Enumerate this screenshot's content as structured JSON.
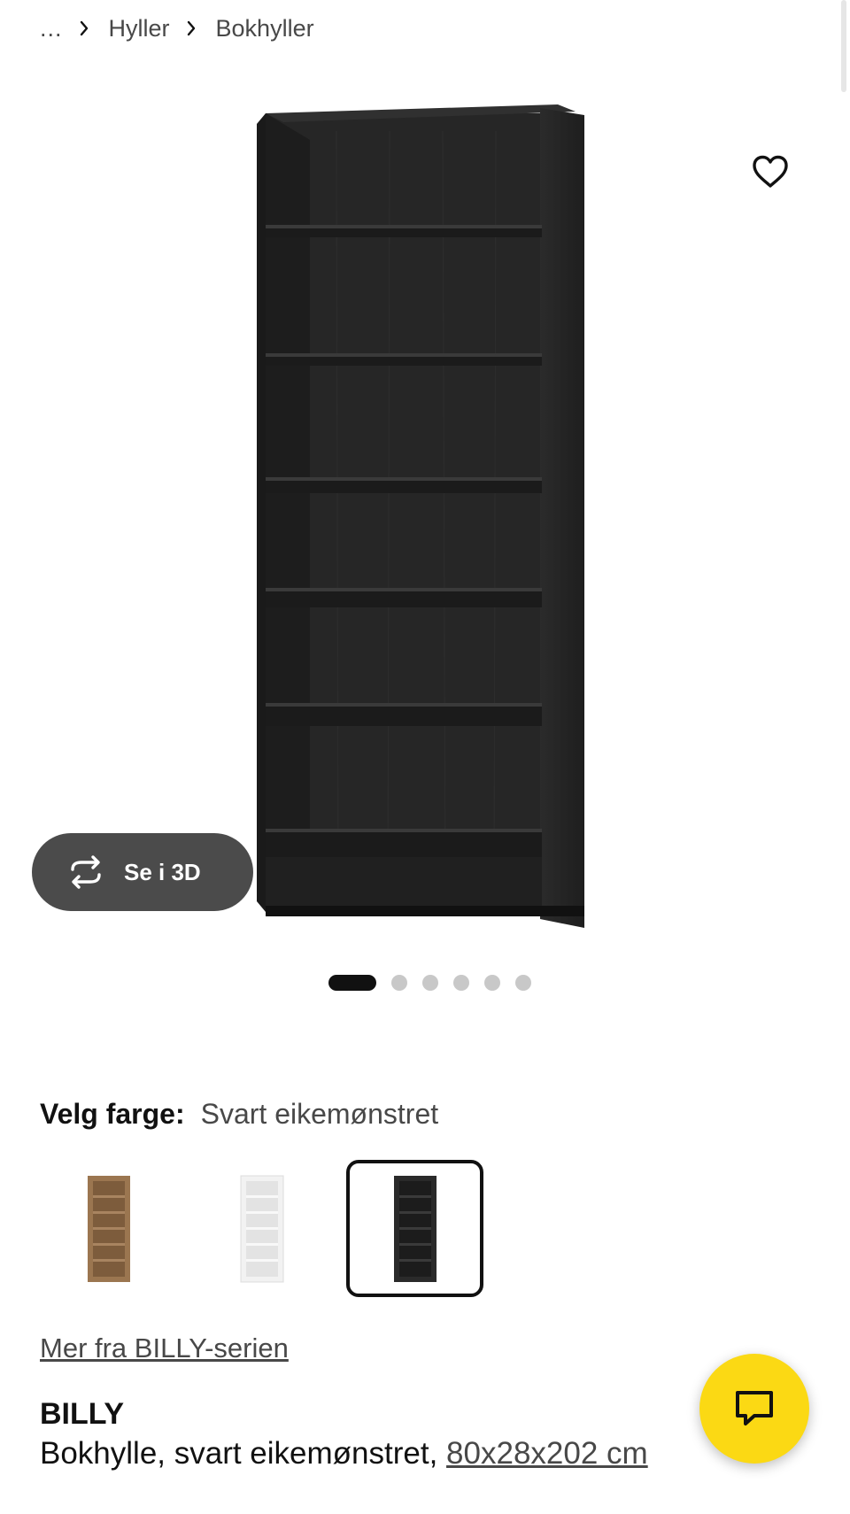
{
  "breadcrumb": {
    "ellipsis": "...",
    "items": [
      "Hyller",
      "Bokhyller"
    ]
  },
  "gallery": {
    "view_3d_label": "Se i 3D",
    "image_count": 6,
    "active_index": 0
  },
  "color": {
    "label": "Velg farge:",
    "value": "Svart eikemønstret",
    "swatches": [
      {
        "name": "brown-oak",
        "selected": false
      },
      {
        "name": "white",
        "selected": false
      },
      {
        "name": "black-oak",
        "selected": true
      }
    ]
  },
  "series_link": "Mer fra BILLY-serien",
  "product": {
    "name": "BILLY",
    "description": "Bokhylle, svart eikemønstret,",
    "dimensions": "80x28x202 cm"
  },
  "colors": {
    "dark_button": "#4b4b4b",
    "chat_yellow": "#fbd914",
    "wood_black": "#2a2a2a"
  },
  "icons": {
    "favorite": "heart-outline-icon",
    "view_3d": "rotate-3d-icon",
    "chat": "chat-bubble-icon",
    "separator": "chevron-right-icon"
  }
}
